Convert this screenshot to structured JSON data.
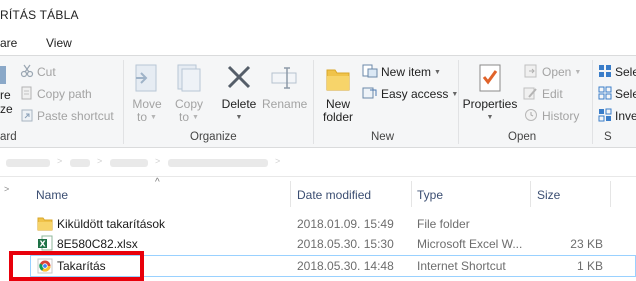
{
  "window": {
    "title": "RÍTÁS TÁBLA"
  },
  "tabs": [
    {
      "label": "are"
    },
    {
      "label": "View"
    }
  ],
  "ribbon": {
    "clipboard": {
      "cut": "Cut",
      "copy_path": "Copy path",
      "paste_shortcut": "Paste shortcut",
      "group_label": "ard",
      "left_fragment_1": "re",
      "left_fragment_2": "ze"
    },
    "organize": {
      "move_to": "Move",
      "move_to_2": "to",
      "copy_to": "Copy",
      "copy_to_2": "to",
      "delete": "Delete",
      "rename": "Rename",
      "group_label": "Organize"
    },
    "new": {
      "new_folder": "New",
      "new_folder_2": "folder",
      "new_item": "New item",
      "easy_access": "Easy access",
      "group_label": "New"
    },
    "open": {
      "properties": "Properties",
      "open": "Open",
      "edit": "Edit",
      "history": "History",
      "group_label": "Open"
    },
    "select": {
      "select_all": "Sele",
      "select_none": "Sele",
      "invert": "Inve",
      "group_label": "S"
    }
  },
  "columns": {
    "name": "Name",
    "date": "Date modified",
    "type": "Type",
    "size": "Size"
  },
  "files": [
    {
      "name": "Kiküldött takarítások",
      "date": "2018.01.09. 15:49",
      "type": "File folder",
      "size": "",
      "icon": "folder-icon"
    },
    {
      "name": "8E580C82.xlsx",
      "date": "2018.05.30. 15:30",
      "type": "Microsoft Excel W...",
      "size": "23 KB",
      "icon": "excel-file-icon"
    },
    {
      "name": "Takarítás",
      "date": "2018.05.30. 14:48",
      "type": "Internet Shortcut",
      "size": "1 KB",
      "icon": "chrome-shortcut-icon"
    }
  ],
  "colors": {
    "highlight_red": "#e8000b",
    "selection_border": "#99d1ff",
    "header_text": "#3b4e72"
  }
}
